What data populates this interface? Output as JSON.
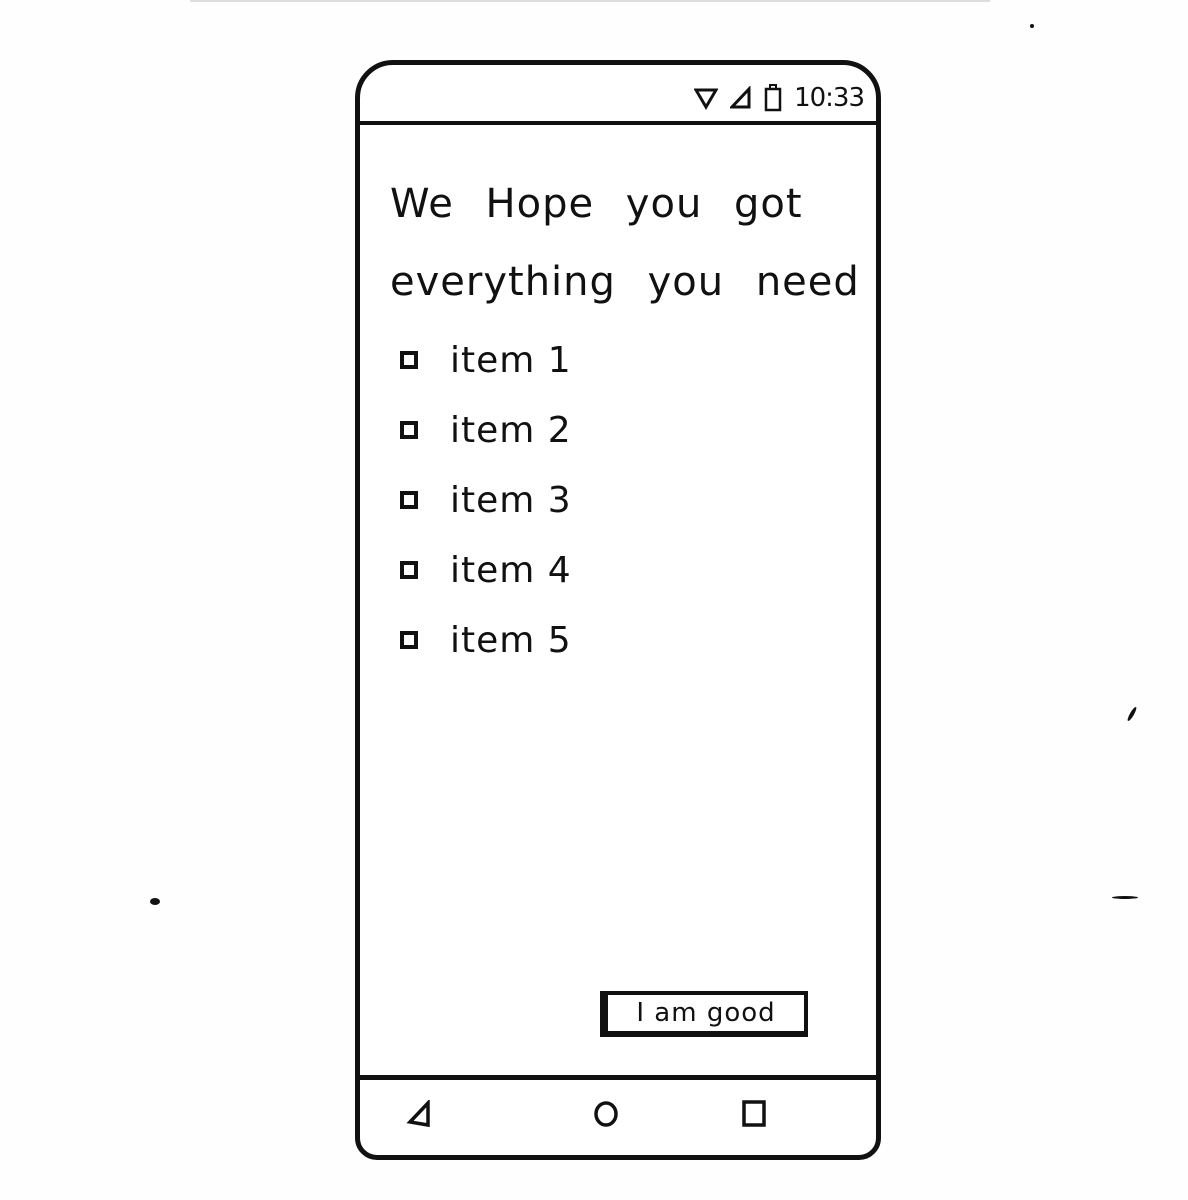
{
  "status_bar": {
    "time": "10:33",
    "icons": [
      "wifi-icon",
      "signal-icon",
      "battery-icon"
    ]
  },
  "main": {
    "headline": "We Hope you got everything you need",
    "checklist": [
      {
        "label": "item 1",
        "checked": false
      },
      {
        "label": "item 2",
        "checked": false
      },
      {
        "label": "item 3",
        "checked": false
      },
      {
        "label": "item 4",
        "checked": false
      },
      {
        "label": "item 5",
        "checked": false
      }
    ],
    "button_label": "I am good"
  },
  "nav_bar": {
    "icons": [
      "back-icon",
      "home-icon",
      "recents-icon"
    ]
  }
}
